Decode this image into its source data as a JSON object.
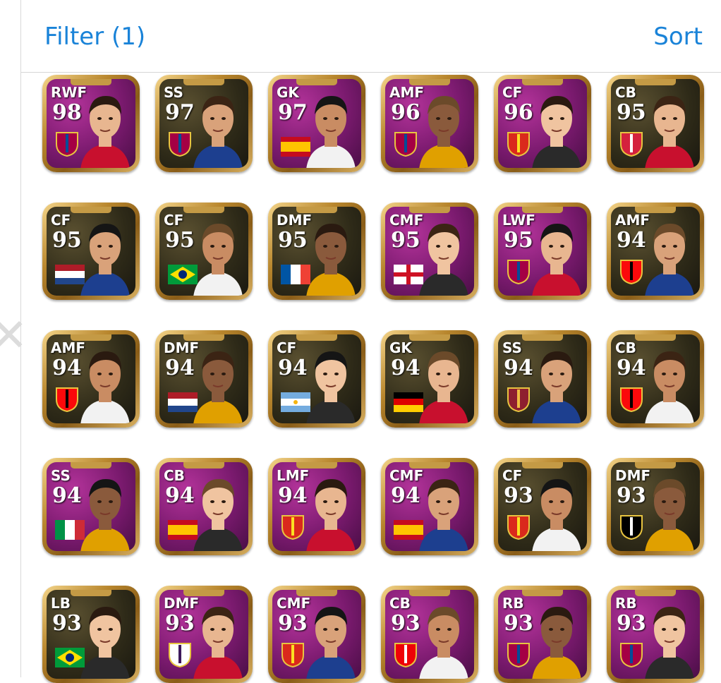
{
  "header": {
    "filter_label": "Filter (1)",
    "sort_label": "Sort"
  },
  "colors": {
    "accent": "#1a83d8"
  },
  "cards": [
    {
      "position": "RWF",
      "rating": "98",
      "badge": "fc-barcelona-crest",
      "bg": "purple"
    },
    {
      "position": "SS",
      "rating": "97",
      "badge": "fc-barcelona-crest",
      "bg": "dark"
    },
    {
      "position": "GK",
      "rating": "97",
      "badge": "spain-flag",
      "bg": "purple"
    },
    {
      "position": "AMF",
      "rating": "96",
      "badge": "fc-barcelona-crest",
      "bg": "purple"
    },
    {
      "position": "CF",
      "rating": "96",
      "badge": "manchester-united-crest",
      "bg": "purple"
    },
    {
      "position": "CB",
      "rating": "95",
      "badge": "club-crest-red",
      "bg": "dark"
    },
    {
      "position": "CF",
      "rating": "95",
      "badge": "netherlands-flag",
      "bg": "dark"
    },
    {
      "position": "CF",
      "rating": "95",
      "badge": "brazil-flag",
      "bg": "dark"
    },
    {
      "position": "DMF",
      "rating": "95",
      "badge": "france-flag",
      "bg": "dark"
    },
    {
      "position": "CMF",
      "rating": "95",
      "badge": "england-flag",
      "bg": "purple"
    },
    {
      "position": "LWF",
      "rating": "95",
      "badge": "fc-barcelona-crest",
      "bg": "purple"
    },
    {
      "position": "AMF",
      "rating": "94",
      "badge": "ac-milan-crest",
      "bg": "dark"
    },
    {
      "position": "AMF",
      "rating": "94",
      "badge": "ac-milan-crest",
      "bg": "dark"
    },
    {
      "position": "DMF",
      "rating": "94",
      "badge": "netherlands-flag",
      "bg": "dark"
    },
    {
      "position": "CF",
      "rating": "94",
      "badge": "argentina-flag",
      "bg": "dark"
    },
    {
      "position": "GK",
      "rating": "94",
      "badge": "germany-flag",
      "bg": "dark"
    },
    {
      "position": "SS",
      "rating": "94",
      "badge": "as-roma-crest",
      "bg": "dark"
    },
    {
      "position": "CB",
      "rating": "94",
      "badge": "ac-milan-crest",
      "bg": "dark"
    },
    {
      "position": "SS",
      "rating": "94",
      "badge": "italy-flag",
      "bg": "purple"
    },
    {
      "position": "CB",
      "rating": "94",
      "badge": "spain-flag",
      "bg": "purple"
    },
    {
      "position": "LMF",
      "rating": "94",
      "badge": "manchester-united-crest",
      "bg": "purple"
    },
    {
      "position": "CMF",
      "rating": "94",
      "badge": "spain-flag",
      "bg": "purple"
    },
    {
      "position": "CF",
      "rating": "93",
      "badge": "manchester-united-crest",
      "bg": "dark"
    },
    {
      "position": "DMF",
      "rating": "93",
      "badge": "juventus-crest",
      "bg": "dark"
    },
    {
      "position": "LB",
      "rating": "93",
      "badge": "brazil-flag",
      "bg": "dark"
    },
    {
      "position": "DMF",
      "rating": "93",
      "badge": "real-madrid-crest",
      "bg": "purple"
    },
    {
      "position": "CMF",
      "rating": "93",
      "badge": "manchester-united-crest",
      "bg": "purple"
    },
    {
      "position": "CB",
      "rating": "93",
      "badge": "arsenal-crest",
      "bg": "purple"
    },
    {
      "position": "RB",
      "rating": "93",
      "badge": "fc-barcelona-crest",
      "bg": "purple"
    },
    {
      "position": "RB",
      "rating": "93",
      "badge": "fc-barcelona-crest",
      "bg": "purple"
    }
  ]
}
